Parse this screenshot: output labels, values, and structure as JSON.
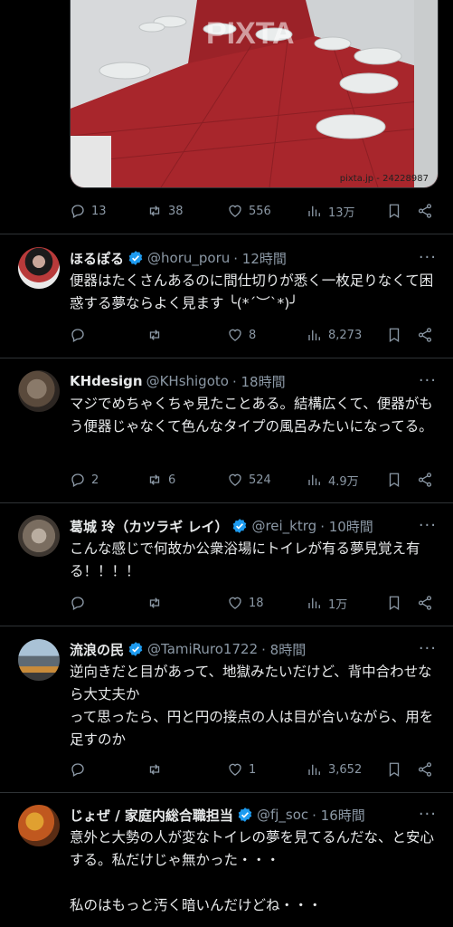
{
  "top_media": {
    "watermark": "PIXTA",
    "credit": "pixta.jp - 24228987"
  },
  "top_actions": {
    "replies": "13",
    "retweets": "38",
    "likes": "556",
    "views": "13万"
  },
  "tweets": [
    {
      "name": "ほるぽる",
      "handle": "@horu_poru",
      "time": "· 12時間",
      "text": "便器はたくさんあるのに間仕切りが悉く一枚足りなくて困惑する夢ならよく見ます ╰(*´︶`*)╯",
      "replies": "",
      "retweets": "",
      "likes": "8",
      "views": "8,273"
    },
    {
      "name": "KHdesign",
      "handle": "@KHshigoto",
      "time": "· 18時間",
      "text": "マジでめちゃくちゃ見たことある。結構広くて、便器がもう便器じゃなくて色んなタイプの風呂みたいになってる。",
      "replies": "2",
      "retweets": "6",
      "likes": "524",
      "views": "4.9万"
    },
    {
      "name": "葛城 玲（カツラギ レイ）",
      "handle": "@rei_ktrg",
      "time": "· 10時間",
      "text": "こんな感じで何故か公衆浴場にトイレが有る夢見覚え有る！！！！",
      "replies": "",
      "retweets": "",
      "likes": "18",
      "views": "1万"
    },
    {
      "name": "流浪の民",
      "handle": "@TamiRuro1722",
      "time": "· 8時間",
      "text": "逆向きだと目があって、地獄みたいだけど、背中合わせなら大丈夫か\nって思ったら、円と円の接点の人は目が合いながら、用を足すのか",
      "replies": "",
      "retweets": "",
      "likes": "1",
      "views": "3,652"
    },
    {
      "name": "じょぜ / 家庭内総合職担当",
      "handle": "@fj_soc",
      "time": "· 16時間",
      "text": "意外と大勢の人が変なトイレの夢を見てるんだな、と安心する。私だけじゃ無かった・・・\n\n私のはもっと汚く暗いんだけどね・・・"
    }
  ],
  "more_label": "···",
  "colors": {
    "background": "#000000",
    "text": "#e7e9ea",
    "muted": "#8b98a5",
    "verified": "#1d9bf0",
    "divider": "#2f3336"
  }
}
